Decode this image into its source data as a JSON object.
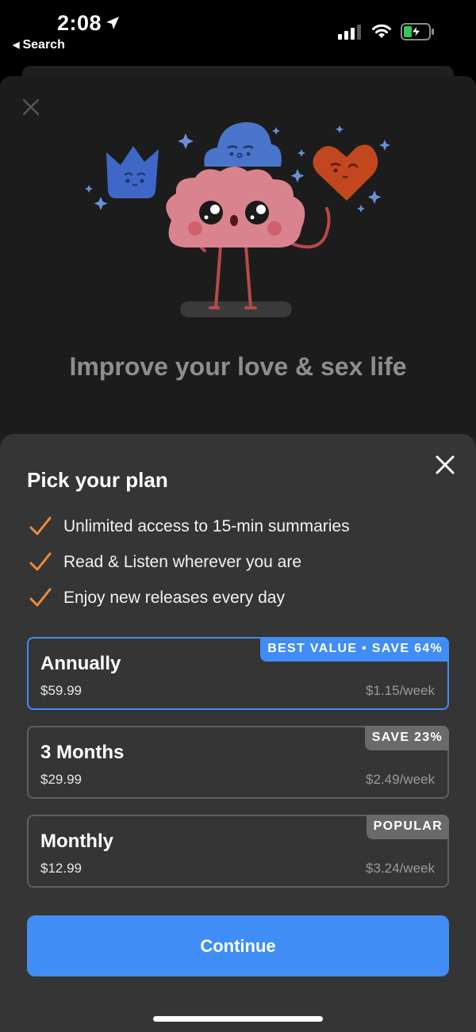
{
  "status_bar": {
    "time": "2:08",
    "back_label": "Search",
    "battery_color": "#34c759"
  },
  "background": {
    "headline": "Improve your love & sex life",
    "illustration": [
      "crown-character",
      "cloud-character",
      "heart-character",
      "brain-character"
    ]
  },
  "modal": {
    "title": "Pick your plan",
    "accent_color": "#3f8df5",
    "check_color": "#f08a3c",
    "features": [
      "Unlimited access to 15-min summaries",
      "Read & Listen wherever you are",
      "Enjoy new releases every day"
    ],
    "plans": [
      {
        "name": "Annually",
        "price": "$59.99",
        "weekly": "$1.15/week",
        "badge": "BEST VALUE • SAVE 64%",
        "selected": true
      },
      {
        "name": "3 Months",
        "price": "$29.99",
        "weekly": "$2.49/week",
        "badge": "SAVE 23%",
        "selected": false
      },
      {
        "name": "Monthly",
        "price": "$12.99",
        "weekly": "$3.24/week",
        "badge": "POPULAR",
        "selected": false
      }
    ],
    "continue_label": "Continue"
  }
}
